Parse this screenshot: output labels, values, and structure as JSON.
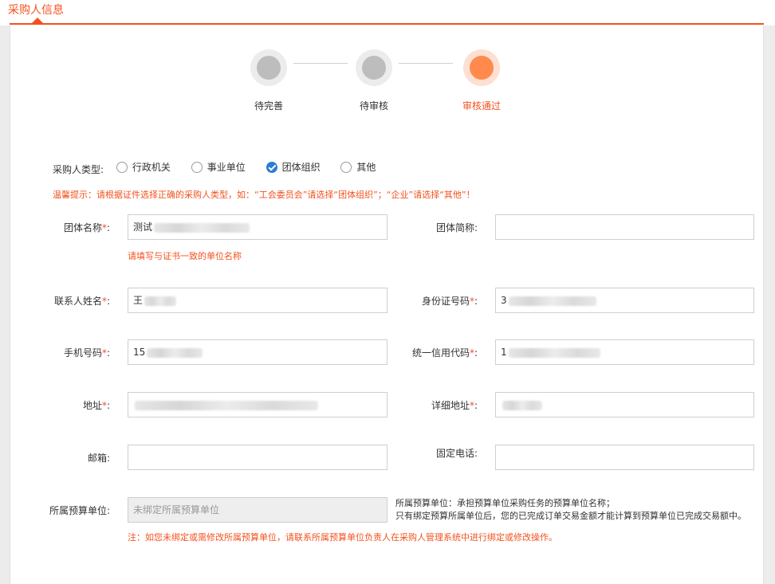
{
  "header": {
    "title": "采购人信息"
  },
  "steps": [
    {
      "label": "待完善",
      "state": "done"
    },
    {
      "label": "待审核",
      "state": "done"
    },
    {
      "label": "审核通过",
      "state": "active"
    }
  ],
  "purchaser_type": {
    "label": "采购人类型:",
    "options": [
      "行政机关",
      "事业单位",
      "团体组织",
      "其他"
    ],
    "selected": "团体组织"
  },
  "warm_tip": "温馨提示：请根据证件选择正确的采购人类型，如：“工会委员会”请选择“团体组织”；“企业”请选择“其他”！",
  "fields": {
    "org_name": {
      "label": "团体名称",
      "value": "测试"
    },
    "org_name_hint": "请填写与证书一致的单位名称",
    "org_short": {
      "label": "团体简称:",
      "value": ""
    },
    "contact_name": {
      "label": "联系人姓名",
      "value": "王"
    },
    "id_number": {
      "label": "身份证号码",
      "value": "3"
    },
    "phone": {
      "label": "手机号码",
      "value": "15"
    },
    "credit_code": {
      "label": "统一信用代码",
      "value": "1"
    },
    "address": {
      "label": "地址",
      "value": ""
    },
    "detail_address": {
      "label": "详细地址",
      "value": ""
    },
    "email": {
      "label": "邮箱:",
      "value": ""
    },
    "landline": {
      "label": "固定电话:",
      "value": ""
    },
    "budget_unit": {
      "label": "所属预算单位:",
      "value": "未绑定所属预算单位"
    }
  },
  "budget_note": {
    "line1": "所属预算单位：承担预算单位采购任务的预算单位名称；",
    "line2": "只有绑定预算所属单位后，您的已完成订单交易金额才能计算到预算单位已完成交易额中。"
  },
  "bottom_note": "注：如您未绑定或需修改所属预算单位，请联系所属预算单位负责人在采购人管理系统中进行绑定或修改操作。",
  "colors": {
    "accent": "#f4511e",
    "check": "#2b7cd3"
  }
}
